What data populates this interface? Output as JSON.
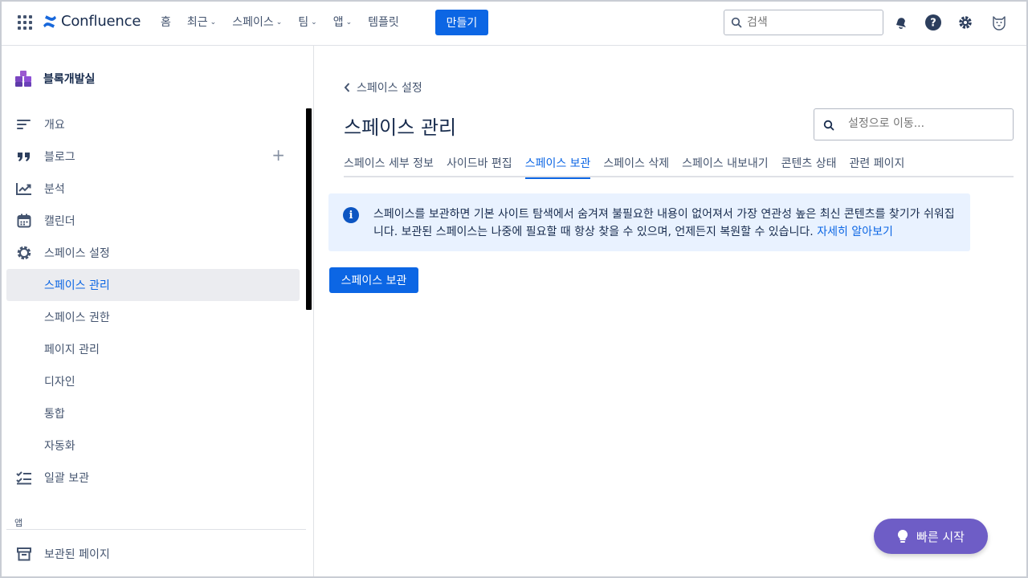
{
  "topnav": {
    "logo_text": "Confluence",
    "items": [
      {
        "label": "홈",
        "has_chevron": false
      },
      {
        "label": "최근",
        "has_chevron": true
      },
      {
        "label": "스페이스",
        "has_chevron": true
      },
      {
        "label": "팀",
        "has_chevron": true
      },
      {
        "label": "앱",
        "has_chevron": true
      },
      {
        "label": "템플릿",
        "has_chevron": false
      }
    ],
    "create_label": "만들기",
    "search_placeholder": "검색",
    "icons": [
      "notifications-icon",
      "help-icon",
      "settings-icon",
      "avatar"
    ]
  },
  "sidebar": {
    "space_name": "블록개발실",
    "items": [
      {
        "label": "개요",
        "icon": "overview-icon"
      },
      {
        "label": "블로그",
        "icon": "quote-icon"
      },
      {
        "label": "분석",
        "icon": "analytics-icon"
      },
      {
        "label": "캘린더",
        "icon": "calendar-icon"
      },
      {
        "label": "스페이스 설정",
        "icon": "gear-icon"
      },
      {
        "label": "스페이스 관리",
        "icon": ""
      },
      {
        "label": "스페이스 권한",
        "icon": ""
      },
      {
        "label": "페이지 관리",
        "icon": ""
      },
      {
        "label": "디자인",
        "icon": ""
      },
      {
        "label": "통합",
        "icon": ""
      },
      {
        "label": "자동화",
        "icon": ""
      },
      {
        "label": "일괄 보관",
        "icon": "bulk-archive-icon"
      }
    ],
    "apps_label": "앱",
    "archived_label": "보관된 페이지"
  },
  "main": {
    "back_label": "스페이스 설정",
    "title": "스페이스 관리",
    "goto_placeholder": "설정으로 이동...",
    "tabs": [
      {
        "label": "스페이스 세부 정보",
        "active": false
      },
      {
        "label": "사이드바 편집",
        "active": false
      },
      {
        "label": "스페이스 보관",
        "active": true
      },
      {
        "label": "스페이스 삭제",
        "active": false
      },
      {
        "label": "스페이스 내보내기",
        "active": false
      },
      {
        "label": "콘텐츠 상태",
        "active": false
      },
      {
        "label": "관련 페이지",
        "active": false
      }
    ],
    "info_text": "스페이스를 보관하면 기본 사이트 탐색에서 숨겨져 불필요한 내용이 없어져서 가장 연관성 높은 최신 콘텐츠를 찾기가 쉬워집니다. 보관된 스페이스는 나중에 필요할 때 항상 찾을 수 있으며, 언제든지 복원할 수 있습니다.",
    "info_link": "자세히 알아보기",
    "archive_button": "스페이스 보관"
  },
  "quick_start": "빠른 시작",
  "colors": {
    "primary": "#0c66e4",
    "info_bg": "#e9f2ff",
    "quick_start_bg": "#6e5dc6",
    "active_sidebar_bg": "#ebecf0"
  }
}
